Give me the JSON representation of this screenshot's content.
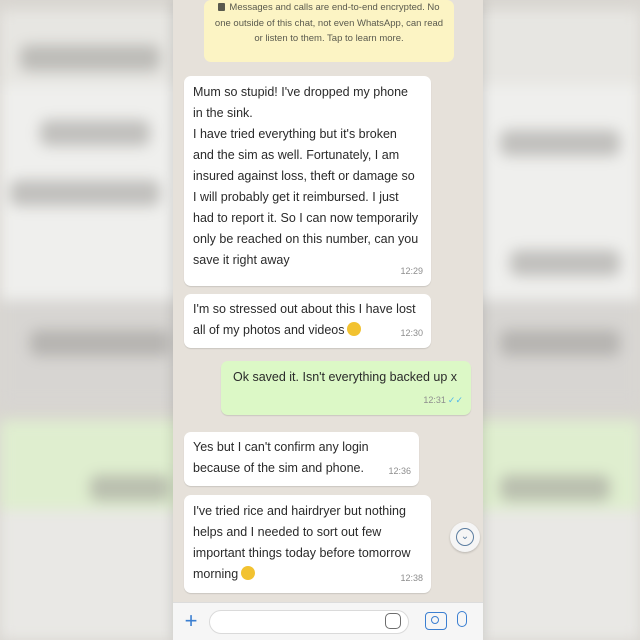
{
  "encryption_notice": "Messages and calls are end-to-end encrypted. No one outside of this chat, not even WhatsApp, can read or listen to them. Tap to learn more.",
  "messages": [
    {
      "direction": "incoming",
      "text": "Mum so stupid! I've dropped my phone in the sink.\nI have tried everything but it's broken and the sim as well. Fortunately, I am insured against loss, theft or damage so I will probably get it reimbursed. I just had to report it. So I can now temporarily only be reached on this number, can you save it right away",
      "time": "12:29"
    },
    {
      "direction": "incoming",
      "text": "I'm so stressed out about this I have lost all of my photos and videos",
      "time": "12:30"
    },
    {
      "direction": "outgoing",
      "text": "Ok saved it. Isn't everything backed up x",
      "time": "12:31"
    },
    {
      "direction": "incoming",
      "text": "Yes but I can't confirm any login because of the sim and phone.",
      "time": "12:36"
    },
    {
      "direction": "incoming",
      "text": "I've tried rice and hairdryer but nothing helps and I needed to sort out few important things today before tomorrow morning",
      "time": "12:38"
    }
  ],
  "colors": {
    "incoming_bubble": "#ffffff",
    "outgoing_bubble": "#dcf8c6",
    "encryption_bubble": "#fcf4c4",
    "accent": "#3b7fd1"
  },
  "icons": {
    "attach": "plus-icon",
    "sticker": "sticker-icon",
    "camera": "camera-icon",
    "mic": "microphone-icon",
    "scroll": "chevron-down-icon",
    "read": "double-check-icon"
  }
}
